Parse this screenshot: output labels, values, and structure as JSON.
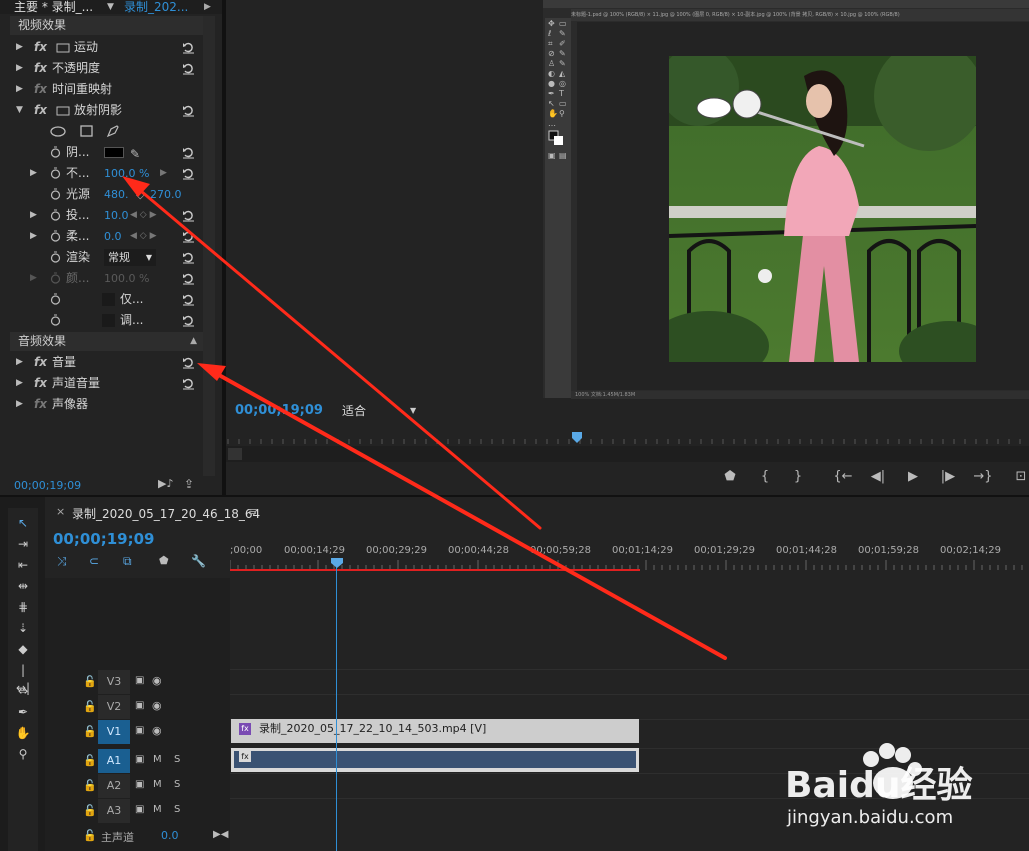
{
  "effect_controls": {
    "tab_main": "主要 * 录制_...",
    "tab_seq": "录制_202...",
    "video_effects_header": "视频效果",
    "audio_effects_header": "音频效果",
    "rows": [
      {
        "label": "运动"
      },
      {
        "label": "不透明度"
      },
      {
        "label": "时间重映射"
      },
      {
        "label": "放射阴影"
      }
    ],
    "params": [
      {
        "label": "阴...",
        "value": ""
      },
      {
        "label": "不...",
        "value": "100.0 %"
      },
      {
        "label": "光源",
        "value": "480.",
        "value2": "270.0"
      },
      {
        "label": "投...",
        "value": "10.0"
      },
      {
        "label": "柔...",
        "value": "0.0"
      },
      {
        "label": "渲染",
        "value": "常规"
      },
      {
        "label": "颜...",
        "value": "100.0 %"
      },
      {
        "label": "仅..."
      },
      {
        "label": "调..."
      }
    ],
    "audio_rows": [
      {
        "label": "音量"
      },
      {
        "label": "声道音量"
      },
      {
        "label": "声像器"
      }
    ],
    "timecode": "00;00;19;09"
  },
  "program_monitor": {
    "timecode": "00;00;19;09",
    "fit": "适合",
    "ps_tabs": "未标题-1.psd @ 100% (RGB/8)  ×  11.jpg @ 100% (图层 0, RGB/8)  ×  10-副本.jpg @ 100% (背景 拷贝, RGB/8)  ×  10.jpg @ 100% (RGB/8)",
    "ps_status": "100%     文档:1.45M/1.83M"
  },
  "timeline": {
    "sequence_tab": "录制_2020_05_17_20_46_18_64",
    "timecode": "00;00;19;09",
    "ruler_labels": [
      ";00;00",
      "00;00;14;29",
      "00;00;29;29",
      "00;00;44;28",
      "00;00;59;28",
      "00;01;14;29",
      "00;01;29;29",
      "00;01;44;28",
      "00;01;59;28",
      "00;02;14;29"
    ],
    "tracks": [
      {
        "id": "V3",
        "type": "video"
      },
      {
        "id": "V2",
        "type": "video"
      },
      {
        "id": "V1",
        "type": "video"
      },
      {
        "id": "A1",
        "type": "audio"
      },
      {
        "id": "A2",
        "type": "audio"
      },
      {
        "id": "A3",
        "type": "audio"
      }
    ],
    "master_label": "主声道",
    "master_value": "0.0",
    "clip_video_label": "录制_2020_05_17_22_10_14_503.mp4 [V]",
    "track_m": "M",
    "track_s": "S"
  },
  "watermark": {
    "brand": "Baidu经验",
    "url": "jingyan.baidu.com"
  },
  "colors": {
    "accent": "#2f8fd6",
    "annotation": "#ff2a1a",
    "track_on": "#1a5f91"
  }
}
